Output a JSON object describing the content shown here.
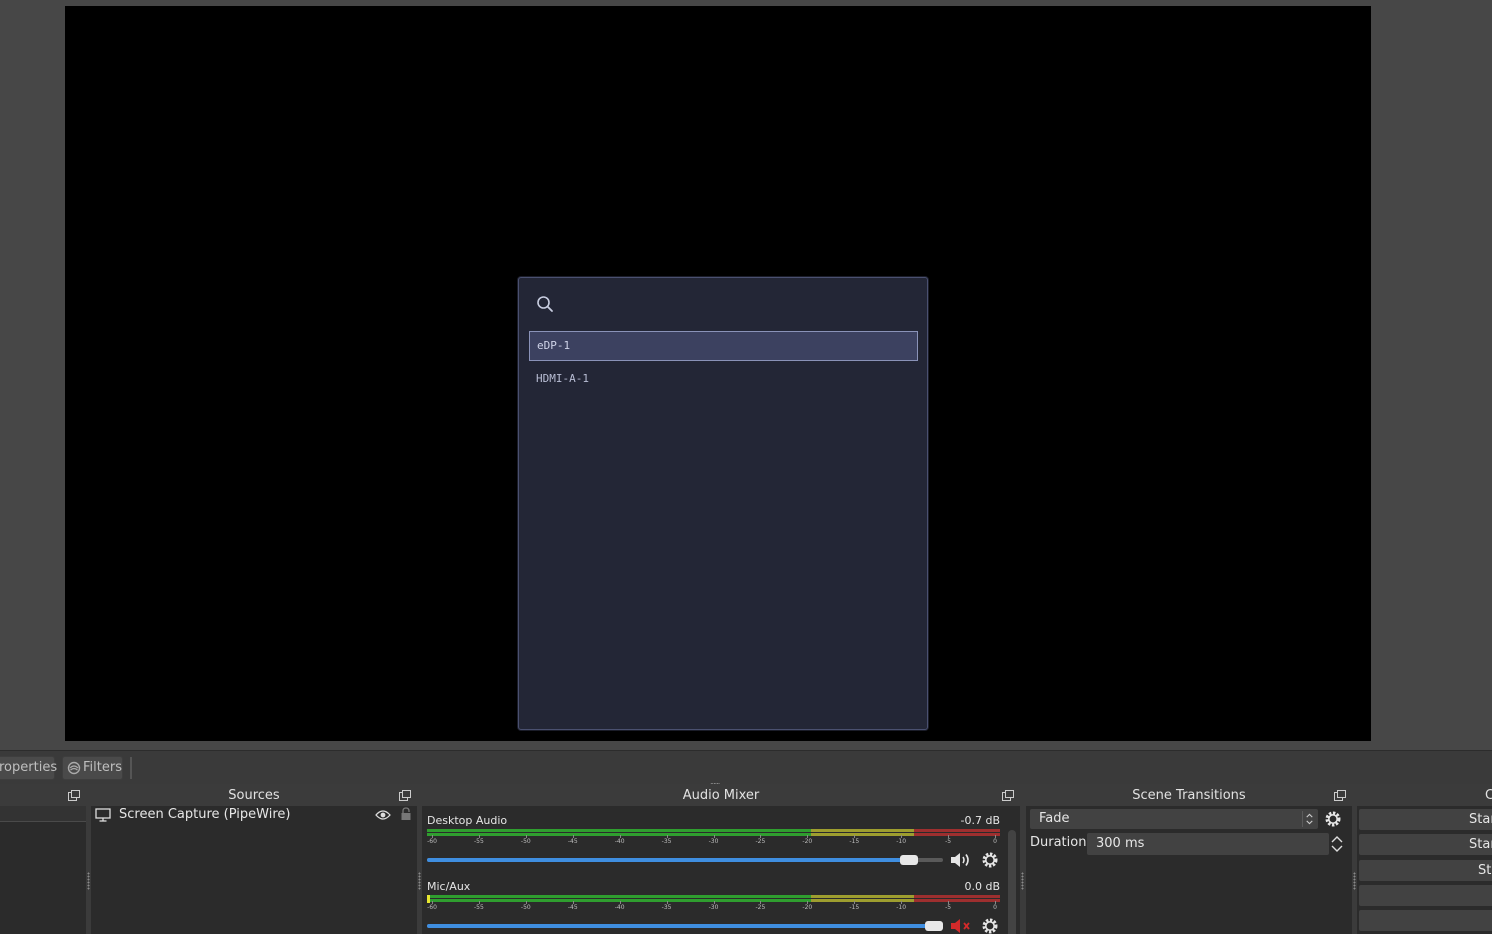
{
  "picker": {
    "search_placeholder": "",
    "items": [
      {
        "label": "eDP-1",
        "selected": true
      },
      {
        "label": "HDMI-A-1",
        "selected": false
      }
    ]
  },
  "toolbar": {
    "properties_label": "roperties",
    "filters_label": "Filters"
  },
  "docks": {
    "scenes": {
      "title": "",
      "selected_scene": ""
    },
    "sources": {
      "title": "Sources",
      "items": [
        {
          "label": "Screen Capture (PipeWire)",
          "visible": true,
          "locked": false
        }
      ]
    },
    "mixer": {
      "title": "Audio Mixer",
      "channels": [
        {
          "name": "Desktop Audio",
          "db": "-0.7 dB",
          "volume": 0.95,
          "muted": false
        },
        {
          "name": "Mic/Aux",
          "db": "0.0 dB",
          "volume": 1.0,
          "muted": true
        }
      ],
      "ticks": [
        "-60",
        "-55",
        "-50",
        "-45",
        "-40",
        "-35",
        "-30",
        "-25",
        "-20",
        "-15",
        "-10",
        "-5",
        "0"
      ]
    },
    "transitions": {
      "title": "Scene Transitions",
      "selected": "Fade",
      "duration_label": "Duration",
      "duration_value": "300 ms"
    },
    "controls": {
      "title": "C",
      "buttons": [
        "Star",
        "Star",
        "St",
        "",
        ""
      ]
    }
  },
  "colors": {
    "meter_green": "#2f9e2f",
    "meter_yellow": "#9e9e2f",
    "meter_red": "#9e2f2f",
    "accent": "#3f8ee0",
    "mute_red": "#d22a2a"
  }
}
